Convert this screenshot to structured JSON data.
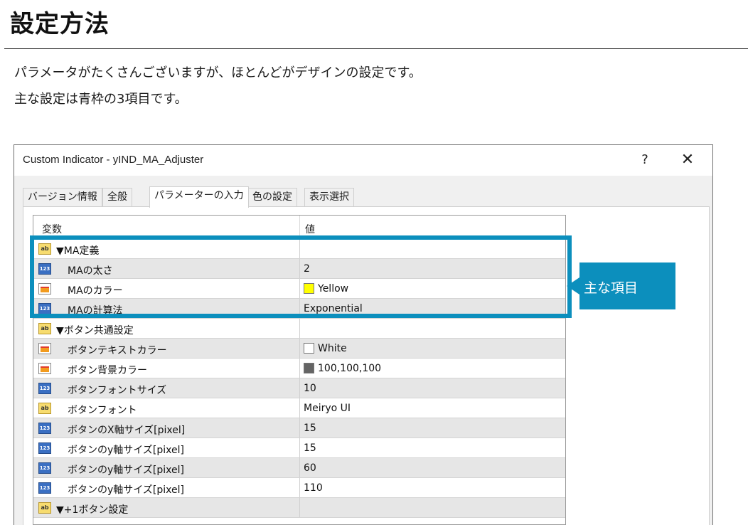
{
  "heading": "設定方法",
  "intro": [
    "パラメータがたくさんございますが、ほとんどがデザインの設定です。",
    "主な設定は青枠の3項目です。"
  ],
  "dialog": {
    "title": "Custom Indicator - yIND_MA_Adjuster",
    "help_label": "?",
    "close_label": "✕",
    "tabs": [
      {
        "label": "バージョン情報",
        "active": false
      },
      {
        "label": "全般",
        "active": false
      },
      {
        "label": "パラメーターの入力",
        "active": true
      },
      {
        "label": "色の設定",
        "active": false
      },
      {
        "label": "表示選択",
        "active": false
      }
    ]
  },
  "grid": {
    "col_variable": "変数",
    "col_value": "値",
    "rows": [
      {
        "icon": "ab-icon",
        "section": true,
        "name": "▼MA定義",
        "value": "",
        "swatch": null
      },
      {
        "icon": "number-icon",
        "section": false,
        "name": "MAの太さ",
        "value": "2",
        "swatch": null
      },
      {
        "icon": "color-icon",
        "section": false,
        "name": "MAのカラー",
        "value": "Yellow",
        "swatch": "#ffff00"
      },
      {
        "icon": "number-icon",
        "section": false,
        "name": "MAの計算法",
        "value": "Exponential",
        "swatch": null
      },
      {
        "icon": "ab-icon",
        "section": true,
        "name": "▼ボタン共通設定",
        "value": "",
        "swatch": null
      },
      {
        "icon": "color-icon",
        "section": false,
        "name": "ボタンテキストカラー",
        "value": "White",
        "swatch": "#ffffff"
      },
      {
        "icon": "color-icon",
        "section": false,
        "name": "ボタン背景カラー",
        "value": "100,100,100",
        "swatch": "#646464"
      },
      {
        "icon": "number-icon",
        "section": false,
        "name": "ボタンフォントサイズ",
        "value": "10",
        "swatch": null
      },
      {
        "icon": "ab-icon",
        "section": false,
        "name": "ボタンフォント",
        "value": "Meiryo UI",
        "swatch": null
      },
      {
        "icon": "number-icon",
        "section": false,
        "name": "ボタンのX軸サイズ[pixel]",
        "value": "15",
        "swatch": null
      },
      {
        "icon": "number-icon",
        "section": false,
        "name": "ボタンのy軸サイズ[pixel]",
        "value": "15",
        "swatch": null
      },
      {
        "icon": "number-icon",
        "section": false,
        "name": "ボタンのy軸サイズ[pixel]",
        "value": "60",
        "swatch": null
      },
      {
        "icon": "number-icon",
        "section": false,
        "name": "ボタンのy軸サイズ[pixel]",
        "value": "110",
        "swatch": null
      },
      {
        "icon": "ab-icon",
        "section": true,
        "name": "▼+1ボタン設定",
        "value": "",
        "swatch": null
      }
    ]
  },
  "callout": {
    "label": "主な項目",
    "color": "#0c8fbd"
  }
}
